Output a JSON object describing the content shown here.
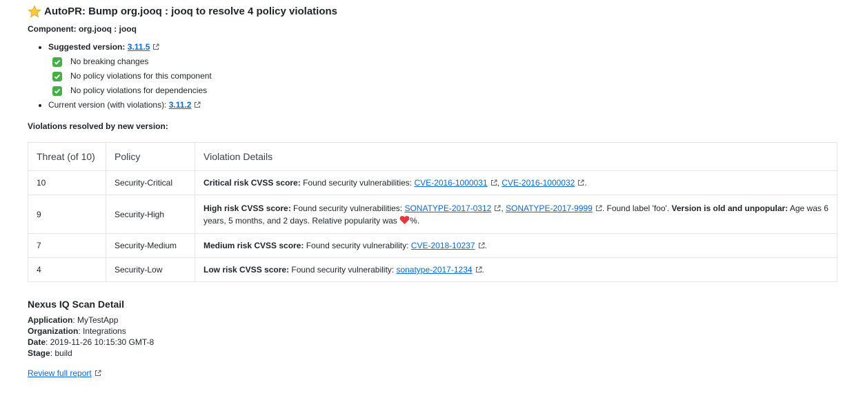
{
  "header": {
    "star_icon": "star-icon",
    "title": "AutoPR: Bump org.jooq : jooq to resolve 4 policy violations",
    "component_line": "Component: org.jooq : jooq"
  },
  "suggested": {
    "label": "Suggested version: ",
    "version": "3.11.5",
    "checks": [
      "No breaking changes",
      "No policy violations for this component",
      "No policy violations for dependencies"
    ]
  },
  "current": {
    "label": "Current version (with violations): ",
    "version": "3.11.2"
  },
  "violations": {
    "heading": "Violations resolved by new version:",
    "columns": [
      "Threat (of 10)",
      "Policy",
      "Violation Details"
    ],
    "rows": [
      {
        "threat": "10",
        "policy": "Security-Critical",
        "bold1": "Critical risk CVSS score:",
        "text1": " Found security vulnerabilities: ",
        "link1": "CVE-2016-1000031",
        "sep": ", ",
        "link2": "CVE-2016-1000032",
        "end": "."
      },
      {
        "threat": "9",
        "policy": "Security-High",
        "bold1": "High risk CVSS score:",
        "text1": " Found security vulnerabilities: ",
        "link1": "SONATYPE-2017-0312",
        "sep": ", ",
        "link2": "SONATYPE-2017-9999",
        "text2": ". Found label 'foo'. ",
        "bold2": "Version is old and unpopular:",
        "text3": " Age was 6 years, 5 months, and 2 days. Relative popularity was ",
        "end": "%."
      },
      {
        "threat": "7",
        "policy": "Security-Medium",
        "bold1": "Medium risk CVSS score:",
        "text1": " Found security vulnerability: ",
        "link1": "CVE-2018-10237",
        "end": "."
      },
      {
        "threat": "4",
        "policy": "Security-Low",
        "bold1": "Low risk CVSS score:",
        "text1": " Found security vulnerability: ",
        "link1": "sonatype-2017-1234",
        "end": "."
      }
    ]
  },
  "nexus": {
    "title": "Nexus IQ Scan Detail",
    "application_label": "Application",
    "application": ": MyTestApp",
    "organization_label": "Organization",
    "organization": ": Integrations",
    "date_label": "Date",
    "date": ": 2019-11-26 10:15:30 GMT-8",
    "stage_label": "Stage",
    "stage": ": build",
    "review_link": "Review full report"
  },
  "colors": {
    "link": "#0969da",
    "check_green": "#43b047",
    "heart_red": "#e5383b",
    "star_yellow": "#f7c948"
  }
}
